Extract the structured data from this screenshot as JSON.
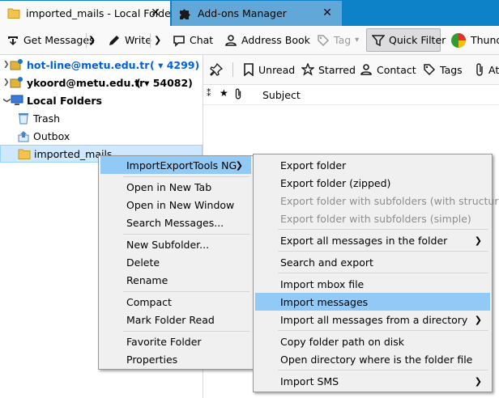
{
  "tabs": [
    {
      "label": "imported_mails - Local Folders",
      "active": true
    },
    {
      "label": "Add-ons Manager",
      "active": false
    }
  ],
  "toolbar": {
    "get_messages": "Get Messages",
    "write": "Write",
    "chat": "Chat",
    "address_book": "Address Book",
    "tag": "Tag",
    "quick_filter": "Quick Filter",
    "thunderbird_menu": "Thund"
  },
  "folders": {
    "account1": {
      "name": "hot-line@metu.edu.tr",
      "unread": "( ▾ 4299)"
    },
    "account2": {
      "name": "ykoord@metu.edu.tr",
      "unread": "( ▾ 54082)"
    },
    "local_folders": "Local Folders",
    "trash": "Trash",
    "outbox": "Outbox",
    "imported": "imported_mails"
  },
  "quick_filter_bar": {
    "unread": "Unread",
    "starred": "Starred",
    "contact": "Contact",
    "tags": "Tags",
    "attachment": "Att"
  },
  "columns": {
    "subject": "Subject"
  },
  "context_menu": {
    "items": [
      {
        "label": "ImportExportTools NG",
        "submenu": true
      },
      {
        "label": "Open in New Tab"
      },
      {
        "label": "Open in New Window"
      },
      {
        "label": "Search Messages..."
      },
      {
        "label": "New Subfolder..."
      },
      {
        "label": "Delete"
      },
      {
        "label": "Rename"
      },
      {
        "label": "Compact"
      },
      {
        "label": "Mark Folder Read"
      },
      {
        "label": "Favorite Folder"
      },
      {
        "label": "Properties"
      }
    ]
  },
  "submenu": {
    "items": [
      {
        "label": "Export folder"
      },
      {
        "label": "Export folder (zipped)"
      },
      {
        "label": "Export folder with subfolders (with structure)",
        "disabled": true
      },
      {
        "label": "Export folder with subfolders (simple)",
        "disabled": true
      },
      {
        "label": "Export all messages in the folder",
        "submenu": true
      },
      {
        "label": "Search and export"
      },
      {
        "label": "Import mbox file"
      },
      {
        "label": "Import messages",
        "highlighted": true
      },
      {
        "label": "Import all messages from a directory",
        "submenu": true
      },
      {
        "label": "Copy folder path on disk"
      },
      {
        "label": "Open directory where is the folder file"
      },
      {
        "label": "Import SMS",
        "submenu": true
      }
    ]
  },
  "colors": {
    "accent": "#0d82c8",
    "highlight": "#91c9f7",
    "selected_folder": "#cde8ff",
    "account_link": "#0060df"
  }
}
